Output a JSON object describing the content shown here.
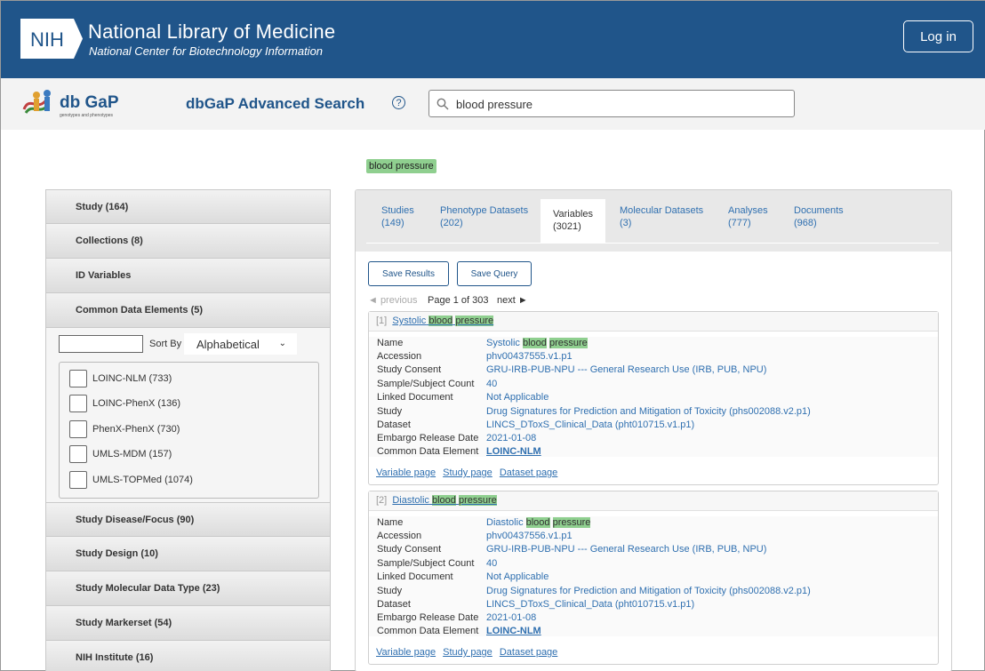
{
  "header": {
    "nih_logo": "NIH",
    "title": "National Library of Medicine",
    "subtitle": "National Center for Biotechnology Information",
    "login_label": "Log in"
  },
  "subheader": {
    "dbgap_logo": "db GaP",
    "dbgap_logo_tagline": "genotypes and phenotypes",
    "title": "dbGaP Advanced Search",
    "help": "?",
    "search_value": "blood pressure"
  },
  "query_chip": "blood pressure",
  "facets": {
    "items_top": [
      "Study (164)",
      "Collections (8)",
      "ID Variables",
      "Common Data Elements (5)"
    ],
    "cde": {
      "sort_label": "Sort By",
      "sort_value": "Alphabetical",
      "options": [
        "LOINC-NLM (733)",
        "LOINC-PhenX (136)",
        "PhenX-PhenX (730)",
        "UMLS-MDM (157)",
        "UMLS-TOPMed (1074)"
      ]
    },
    "items_bottom": [
      "Study Disease/Focus (90)",
      "Study Design (10)",
      "Study Molecular Data Type (23)",
      "Study Markerset (54)",
      "NIH Institute (16)"
    ]
  },
  "tabs": [
    {
      "label": "Studies",
      "count": "(149)"
    },
    {
      "label": "Phenotype Datasets",
      "count": "(202)"
    },
    {
      "label": "Variables",
      "count": "(3021)"
    },
    {
      "label": "Molecular Datasets",
      "count": "(3)"
    },
    {
      "label": "Analyses",
      "count": "(777)"
    },
    {
      "label": "Documents",
      "count": "(968)"
    }
  ],
  "actions": {
    "save_results": "Save Results",
    "save_query": "Save Query"
  },
  "pager": {
    "prev": "◄ previous",
    "info": "Page 1 of 303",
    "next": "next ►"
  },
  "results": [
    {
      "index": "[1]",
      "title_pre": "Systolic",
      "title_hl1": "blood",
      "title_hl2": "pressure",
      "fields": [
        [
          "Name",
          "Systolic blood pressure"
        ],
        [
          "Accession",
          "phv00437555.v1.p1"
        ],
        [
          "Study Consent",
          "GRU-IRB-PUB-NPU --- General Research Use (IRB, PUB, NPU)"
        ],
        [
          "Sample/Subject Count",
          "40"
        ],
        [
          "Linked Document",
          "Not Applicable"
        ],
        [
          "Study",
          "Drug Signatures for Prediction and Mitigation of Toxicity (phs002088.v2.p1)"
        ],
        [
          "Dataset",
          "LINCS_DToxS_Clinical_Data (pht010715.v1.p1)"
        ],
        [
          "Embargo Release Date",
          "2021-01-08"
        ],
        [
          "Common Data Element",
          "LOINC-NLM"
        ]
      ],
      "links": [
        "Variable page",
        "Study page",
        "Dataset page"
      ]
    },
    {
      "index": "[2]",
      "title_pre": "Diastolic",
      "title_hl1": "blood",
      "title_hl2": "pressure",
      "fields": [
        [
          "Name",
          "Diastolic blood pressure"
        ],
        [
          "Accession",
          "phv00437556.v1.p1"
        ],
        [
          "Study Consent",
          "GRU-IRB-PUB-NPU --- General Research Use (IRB, PUB, NPU)"
        ],
        [
          "Sample/Subject Count",
          "40"
        ],
        [
          "Linked Document",
          "Not Applicable"
        ],
        [
          "Study",
          "Drug Signatures for Prediction and Mitigation of Toxicity (phs002088.v2.p1)"
        ],
        [
          "Dataset",
          "LINCS_DToxS_Clinical_Data (pht010715.v1.p1)"
        ],
        [
          "Embargo Release Date",
          "2021-01-08"
        ],
        [
          "Common Data Element",
          "LOINC-NLM"
        ]
      ],
      "links": [
        "Variable page",
        "Study page",
        "Dataset page"
      ]
    }
  ],
  "colors": {
    "header_bg": "#20558a",
    "highlight": "#8fcf8f",
    "link": "#3070b0"
  }
}
